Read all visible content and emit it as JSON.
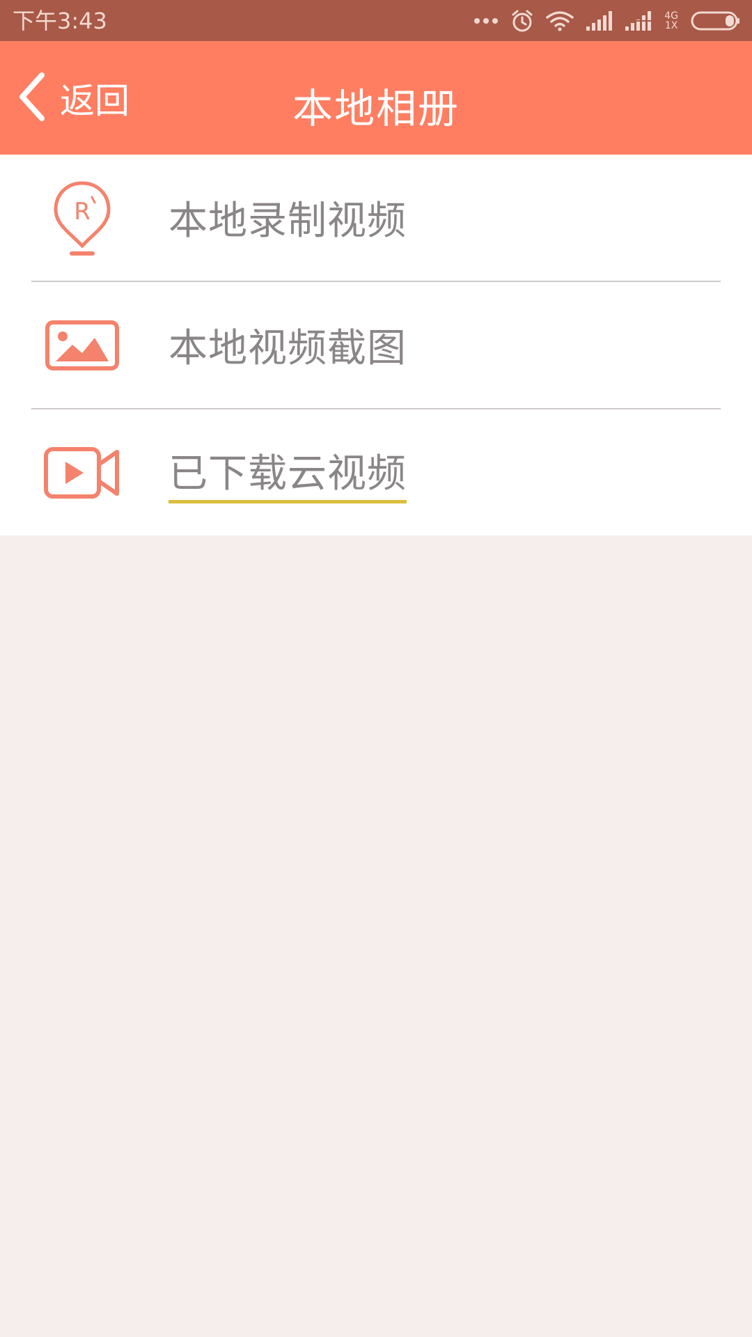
{
  "status_bar": {
    "time": "下午3:43",
    "network_top": "4G",
    "network_bottom": "1X",
    "icons": [
      "more-dots-icon",
      "alarm-icon",
      "wifi-icon",
      "signal-icon",
      "signal-2-icon",
      "battery-icon"
    ]
  },
  "header": {
    "back_label": "返回",
    "title": "本地相册"
  },
  "menu": {
    "items": [
      {
        "label": "本地录制视频",
        "icon": "record-pin-icon"
      },
      {
        "label": "本地视频截图",
        "icon": "picture-icon"
      },
      {
        "label": "已下载云视频",
        "icon": "video-camera-icon"
      }
    ]
  },
  "colors": {
    "status_bar": "#a85947",
    "header": "#ff7e62",
    "icon_accent": "#f4826c",
    "label_text": "#8a8688",
    "underline": "#d9bd3c",
    "background": "#f5eeec"
  }
}
